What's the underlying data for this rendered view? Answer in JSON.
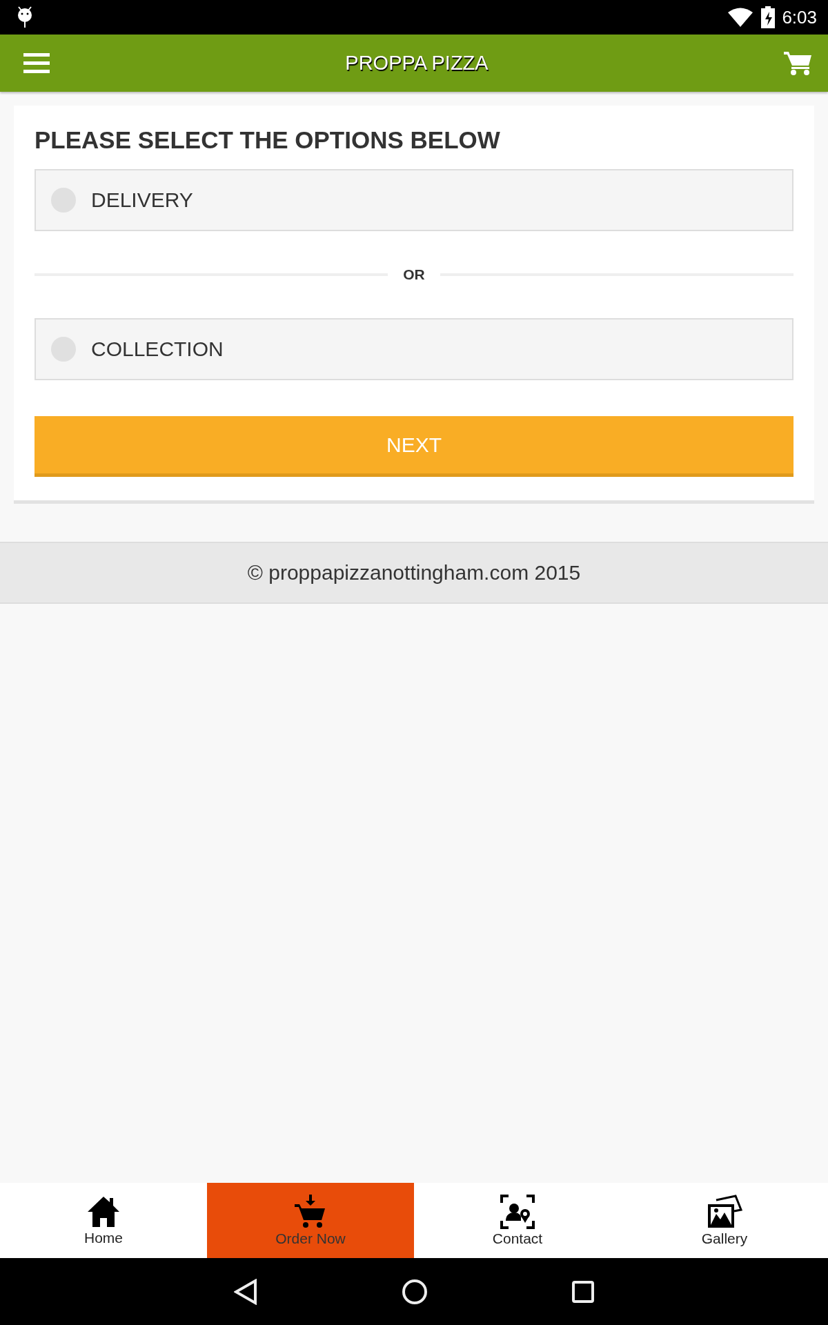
{
  "status_bar": {
    "time": "6:03"
  },
  "header": {
    "title": "PROPPA PIZZA"
  },
  "form": {
    "heading": "PLEASE SELECT THE OPTIONS BELOW",
    "options": [
      {
        "label": "DELIVERY",
        "selected": false
      },
      {
        "label": "COLLECTION",
        "selected": false
      }
    ],
    "separator": "OR",
    "button": "NEXT"
  },
  "footer": {
    "text": "© proppapizzanottingham.com 2015"
  },
  "bottom_nav": [
    {
      "label": "Home",
      "kind": "home",
      "selected": false
    },
    {
      "label": "Order Now",
      "kind": "basket",
      "selected": true
    },
    {
      "label": "Contact",
      "kind": "contact",
      "selected": false
    },
    {
      "label": "Gallery",
      "kind": "gallery",
      "selected": false
    }
  ]
}
